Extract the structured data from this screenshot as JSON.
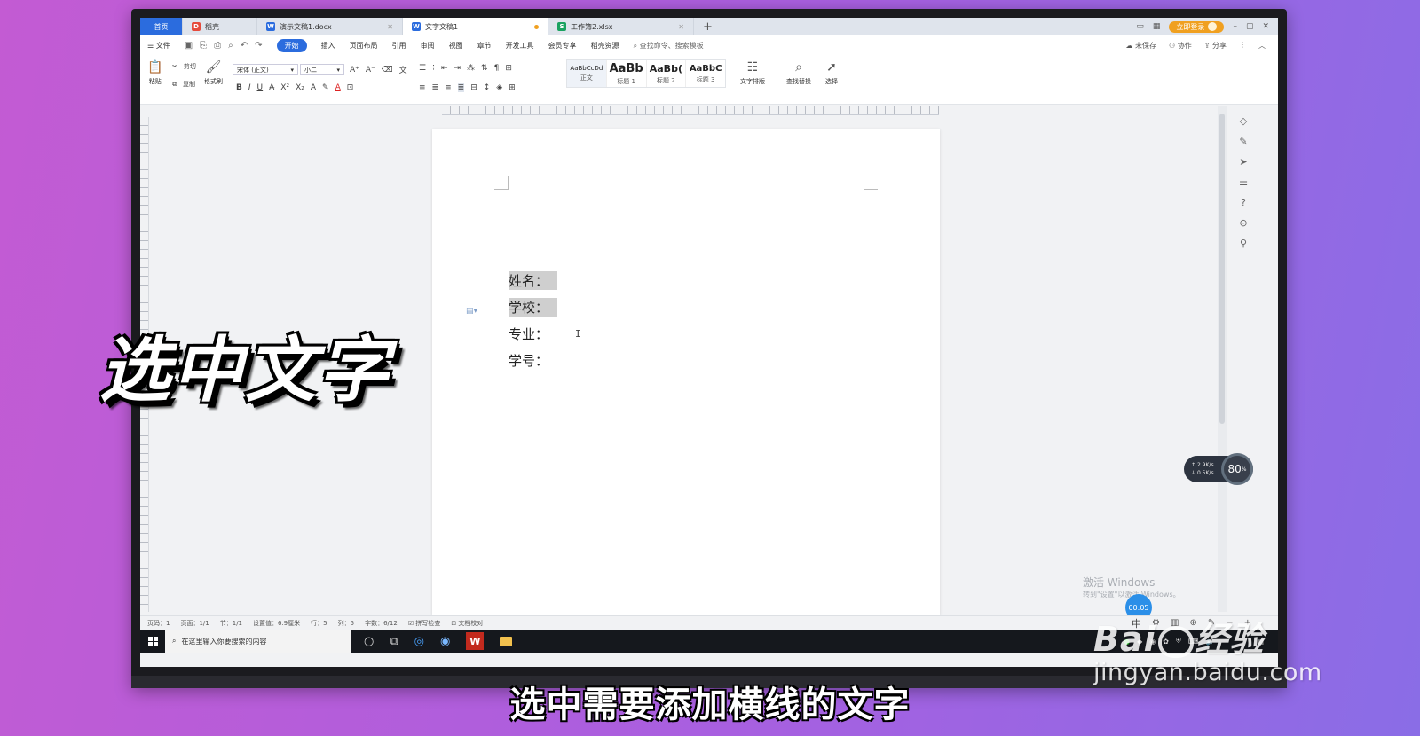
{
  "tabs": [
    {
      "label": "首页"
    },
    {
      "label": "稻壳"
    },
    {
      "label": "演示文稿1.docx"
    },
    {
      "label": "文字文稿1"
    },
    {
      "label": "工作簿2.xlsx"
    }
  ],
  "login_button": "立即登录",
  "menu": {
    "file": "文件",
    "items": [
      "开始",
      "插入",
      "页面布局",
      "引用",
      "审阅",
      "视图",
      "章节",
      "开发工具",
      "会员专享",
      "稻壳资源"
    ],
    "search": "查找命令、搜索模板",
    "right": [
      "未保存",
      "协作",
      "分享"
    ]
  },
  "ribbon": {
    "paste": "粘贴",
    "cut": "剪切",
    "copy": "复制",
    "format_painter": "格式刷",
    "font_name": "宋体 (正文)",
    "font_size": "小二",
    "styles": [
      {
        "preview": "AaBbCcDd",
        "name": "正文"
      },
      {
        "preview": "AaBb",
        "name": "标题 1"
      },
      {
        "preview": "AaBb(",
        "name": "标题 2"
      },
      {
        "preview": "AaBbC",
        "name": "标题 3"
      }
    ],
    "text_layout": "文字排版",
    "find_replace": "查找替换",
    "select": "选择"
  },
  "document": {
    "lines": [
      "姓名：",
      "学校：",
      "专业：",
      "学号："
    ]
  },
  "status": {
    "page_num": "页码：1",
    "pages": "页面：1/1",
    "section": "节：1/1",
    "setting": "设置值：6.9厘米",
    "row": "行：5",
    "col": "列：5",
    "words": "字数：6/12",
    "spell": "拼写检查",
    "proof": "文档校对",
    "ime": "中"
  },
  "net_widget": {
    "up": "2.9",
    "down": "0.5",
    "percent": "80"
  },
  "activate": {
    "title": "激活 Windows",
    "sub": "转到\"设置\"以激活 Windows。"
  },
  "timer": "00:05",
  "taskbar": {
    "search_placeholder": "在这里输入你要搜索的内容"
  },
  "overlay": {
    "big_title": "选中文字",
    "subtitle": "选中需要添加横线的文字",
    "watermark_logo_a": "Bai",
    "watermark_logo_b": "经验",
    "watermark_url": "jingyan.baidu.com"
  }
}
